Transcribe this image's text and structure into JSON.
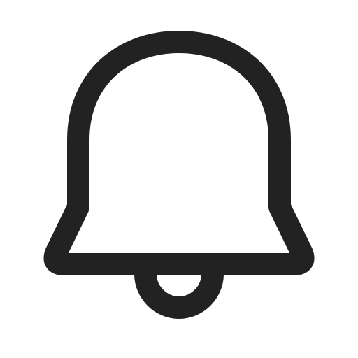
{
  "icon": {
    "name": "bell-icon",
    "stroke_color": "#222222",
    "background_color": "#ffffff"
  }
}
